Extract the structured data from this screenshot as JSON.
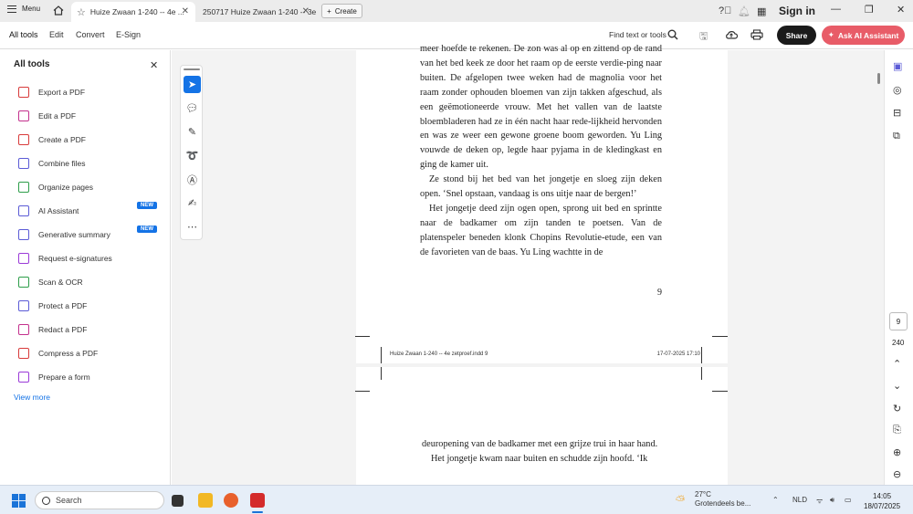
{
  "tabbar": {
    "menu_label": "Menu",
    "tabs": [
      {
        "label": "Huize Zwaan 1-240 -- 4e ..."
      },
      {
        "label": "250717 Huize Zwaan 1-240 -- 3e z..."
      }
    ],
    "create_label": "Create",
    "signin_label": "Sign in"
  },
  "toolbar": {
    "items": [
      "All tools",
      "Edit",
      "Convert",
      "E-Sign"
    ],
    "find_label": "Find text or tools",
    "share_label": "Share",
    "ai_label": "Ask AI Assistant"
  },
  "sidebar": {
    "title": "All tools",
    "tools": [
      {
        "label": "Export a PDF",
        "color": "#d83b3b"
      },
      {
        "label": "Edit a PDF",
        "color": "#c4318d"
      },
      {
        "label": "Create a PDF",
        "color": "#d83b3b"
      },
      {
        "label": "Combine files",
        "color": "#5b5bd6"
      },
      {
        "label": "Organize pages",
        "color": "#2e9e4a"
      },
      {
        "label": "AI Assistant",
        "color": "#5b5bd6",
        "badge": "NEW"
      },
      {
        "label": "Generative summary",
        "color": "#5b5bd6",
        "badge": "NEW"
      },
      {
        "label": "Request e-signatures",
        "color": "#9b3bd8"
      },
      {
        "label": "Scan & OCR",
        "color": "#2e9e4a"
      },
      {
        "label": "Protect a PDF",
        "color": "#5b5bd6"
      },
      {
        "label": "Redact a PDF",
        "color": "#c4318d"
      },
      {
        "label": "Compress a PDF",
        "color": "#d83b3b"
      },
      {
        "label": "Prepare a form",
        "color": "#9b3bd8"
      }
    ],
    "view_more": "View more"
  },
  "document": {
    "page1_paragraphs": [
      "meer hoefde te rekenen. De zon was al op en zittend op de rand van het bed keek ze door het raam op de eerste verdie-ping naar buiten. De afgelopen twee weken had de magnolia voor het raam zonder ophouden bloemen van zijn takken afgeschud, als een geëmotioneerde vrouw. Met het vallen van de laatste bloembladeren had ze in één nacht haar rede-lijkheid hervonden en was ze weer een gewone groene boom geworden. Yu Ling vouwde de deken op, legde haar pyjama in de kledingkast en ging de kamer uit.",
      "Ze stond bij het bed van het jongetje en sloeg zijn deken open. ‘Snel opstaan, vandaag is ons uitje naar de bergen!’",
      "Het jongetje deed zijn ogen open, sprong uit bed en sprintte naar de badkamer om zijn tanden te poetsen. Van de platenspeler beneden klonk Chopins Revolutie-etude, een van de favorieten van de baas. Yu Ling wachtte in de"
    ],
    "page_number": "9",
    "slug_left": "Huize Zwaan 1-240 -- 4e zetproef.indd   9",
    "slug_right": "17-07-2025   17:10",
    "page2_paragraphs": [
      "deuropening van de badkamer met een grijze trui in haar hand.",
      "Het jongetje kwam naar buiten en schudde zijn hoofd. ‘Ik"
    ]
  },
  "pagenav": {
    "current": "9",
    "total": "240"
  },
  "taskbar": {
    "search_placeholder": "Search",
    "temperature": "27°C",
    "weather_desc": "Grotendeels be...",
    "language": "NLD",
    "time": "14:05",
    "date": "18/07/2025"
  }
}
